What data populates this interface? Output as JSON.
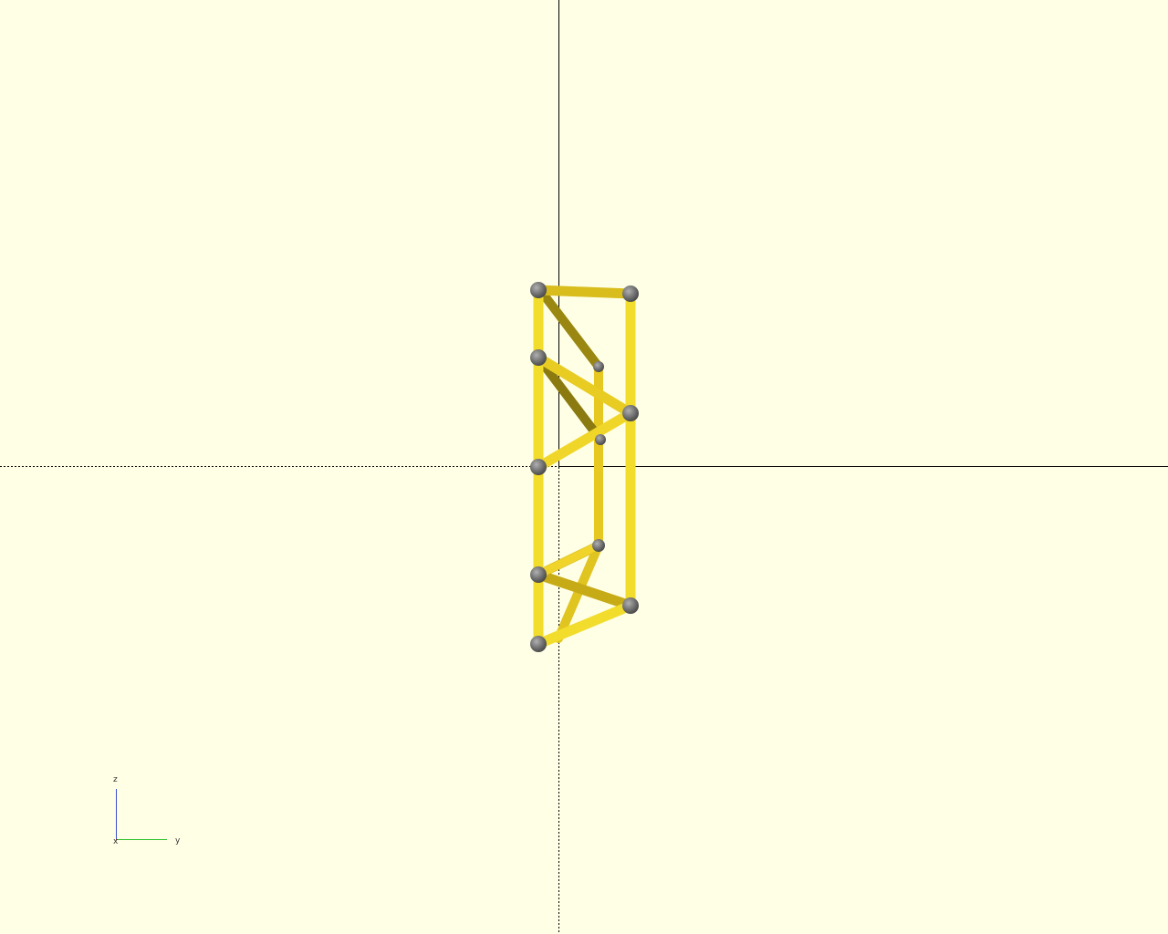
{
  "viewport": {
    "background_color": "#ffffe5",
    "strut_color": "#f2dc2c",
    "strut_shadow_color": "#8a7a10",
    "node_color": "#767676"
  },
  "axes_gizmo": {
    "z_label": "z",
    "x_label": "x",
    "y_label": "y",
    "z_color": "#3a4fd0",
    "y_color": "#2bbf2b",
    "x_color": "#cc2222"
  }
}
